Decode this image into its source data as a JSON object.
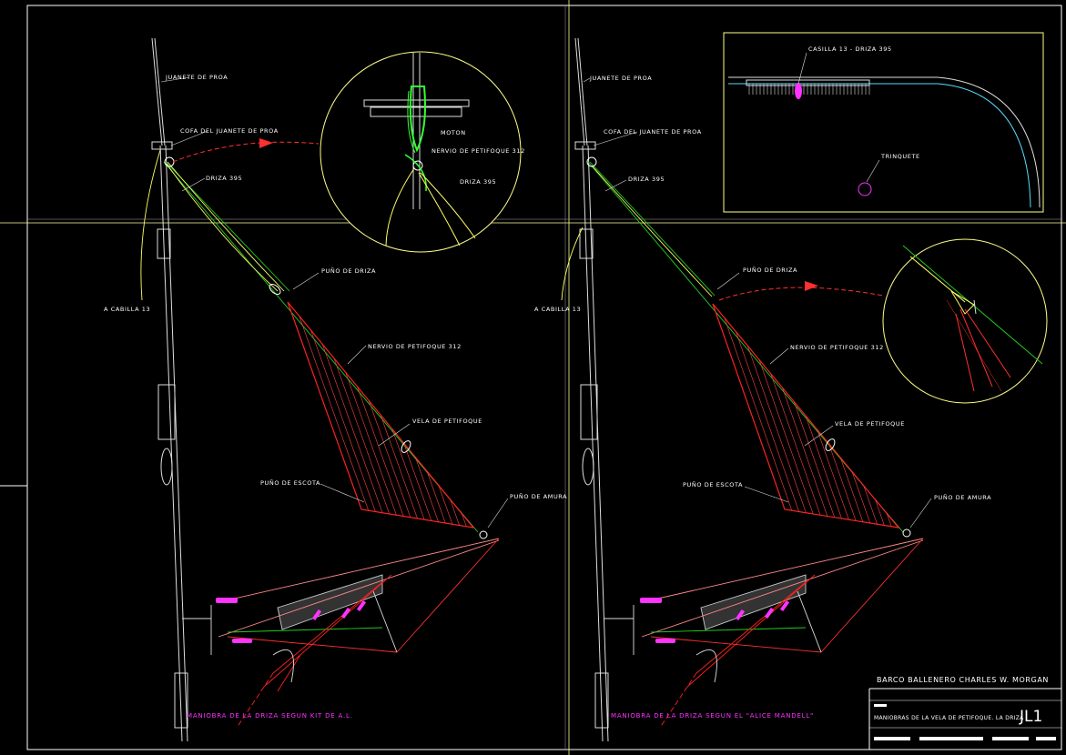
{
  "left_view": {
    "labels": {
      "juanete": "JUANETE DE PROA",
      "cofa": "COFA DEL JUANETE DE PROA",
      "driza": "DRIZA 395",
      "cabilla": "A CABILLA 13",
      "puno_driza": "PUÑO DE DRIZA",
      "nervio": "NERVIO DE PETIFOQUE 312",
      "vela": "VELA DE PETIFOQUE",
      "puno_escota": "PUÑO DE ESCOTA",
      "puno_amura": "PUÑO DE AMURA"
    },
    "detail": {
      "moton": "MOTON",
      "nervio": "NERVIO DE PETIFOQUE 312",
      "driza": "DRIZA 395"
    },
    "caption": "MANIOBRA DE LA DRIZA SEGUN KIT DE A.L."
  },
  "right_view": {
    "labels": {
      "juanete": "JUANETE DE PROA",
      "cofa": "COFA DEL JUANETE DE PROA",
      "driza": "DRIZA 395",
      "cabilla": "A CABILLA 13",
      "puno_driza": "PUÑO DE DRIZA",
      "nervio": "NERVIO DE PETIFOQUE 312",
      "vela": "VELA DE PETIFOQUE",
      "puno_escota": "PUÑO DE ESCOTA",
      "puno_amura": "PUÑO DE AMURA"
    },
    "plan": {
      "casilla": "CASILLA 13 - DRIZA 395",
      "trinquete": "TRINQUETE"
    },
    "caption": "MANIOBRA DE LA DRIZA SEGUN EL \"ALICE MANDELL\""
  },
  "title_block": {
    "vessel": "BARCO BALLENERO CHARLES W. MORGAN",
    "description": "MANIOBRAS DE LA VELA DE PETIFOQUE. LA DRIZA",
    "sheet": "JL1"
  },
  "colors": {
    "background": "#000000",
    "frame": "#ffffff",
    "guide": "#ffff88",
    "sail": "#ff2020",
    "rope": "#ffff66",
    "stay": "#22cc22",
    "block": "#33ff33",
    "highlight": "#ff33ff",
    "hull": "#55ddff"
  }
}
